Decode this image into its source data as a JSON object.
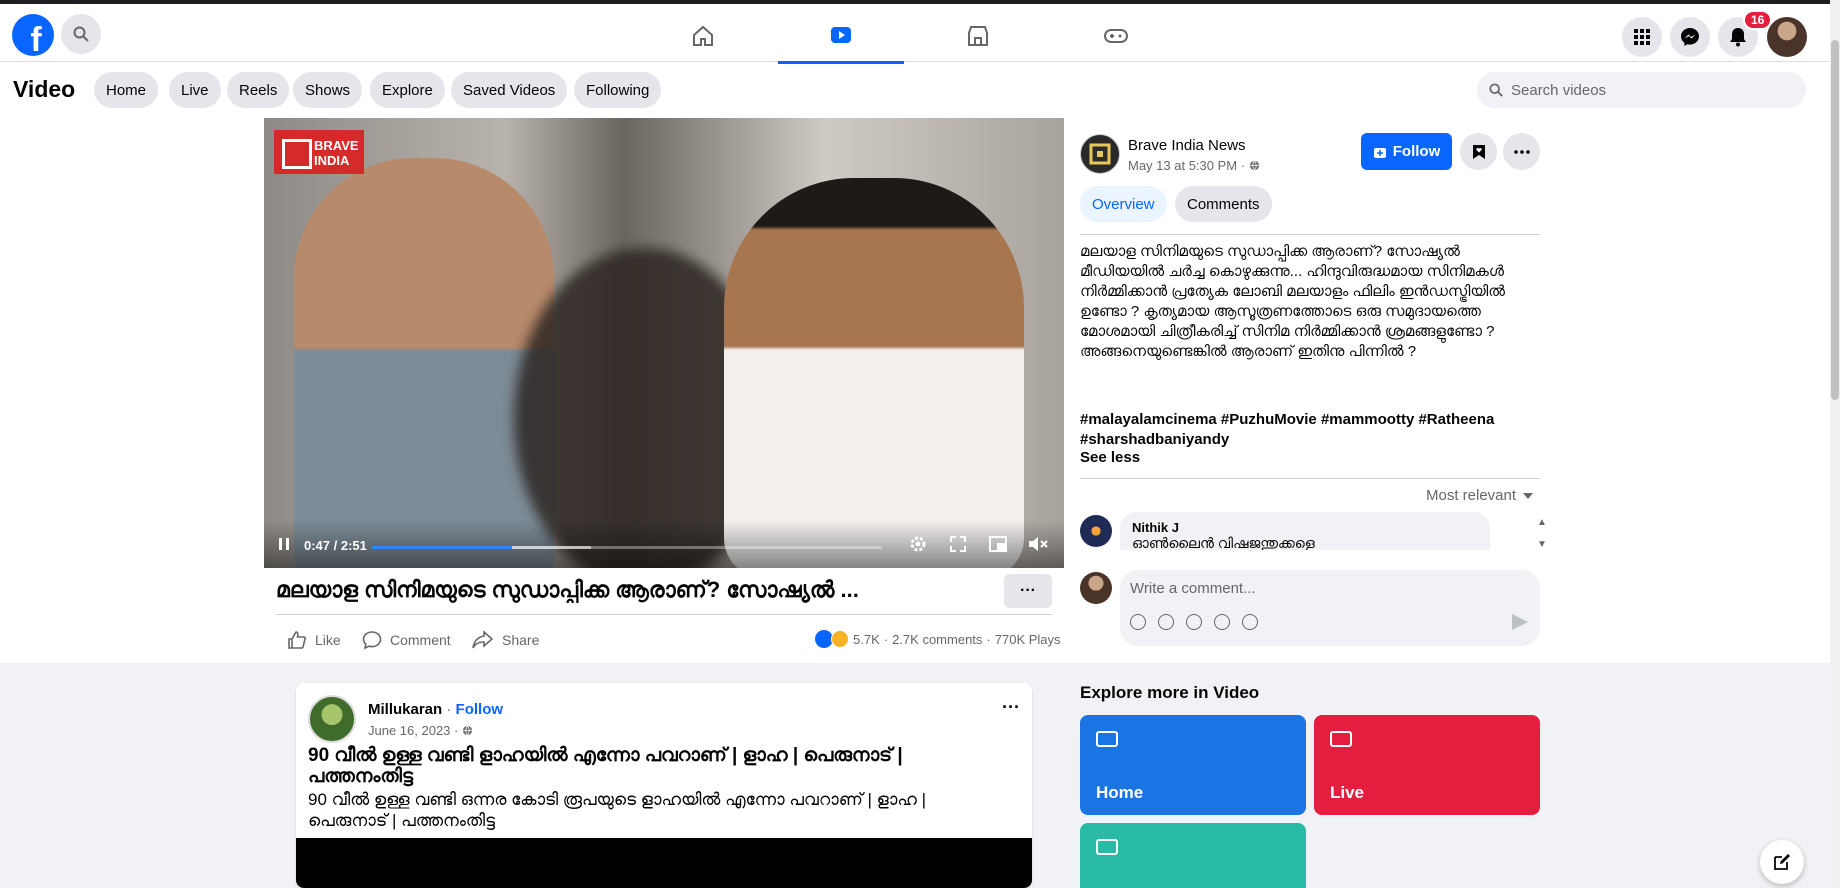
{
  "nav": {
    "notification_count": "16"
  },
  "video_header": {
    "title": "Video",
    "pills": [
      "Home",
      "Live",
      "Reels",
      "Shows",
      "Explore",
      "Saved Videos",
      "Following"
    ],
    "search_placeholder": "Search videos"
  },
  "player": {
    "logo_text": "BRAVE INDIA",
    "time": "0:47 / 2:51",
    "progress_fraction": 0.275,
    "buffer_fraction": 0.43
  },
  "video": {
    "title": "മലയാള സിനിമയുടെ സുഡാപ്പിക്ക ആരാണ്? സോഷ്യൽ ...",
    "more": "···",
    "actions": {
      "like": "Like",
      "comment": "Comment",
      "share": "Share"
    },
    "stats": {
      "reactions": "5.7K",
      "comments": "2.7K comments",
      "plays": "770K Plays"
    }
  },
  "channel": {
    "name": "Brave India News",
    "date": "May 13 at 5:30 PM ·",
    "follow_label": "Follow",
    "tabs": [
      "Overview",
      "Comments"
    ],
    "description": "മലയാള സിനിമയുടെ സുഡാപ്പിക്ക ആരാണ്? സോഷ്യൽ മീഡിയയിൽ ചർച്ച കൊഴുക്കുന്നു... ഹിന്ദുവിരുദ്ധമായ സിനിമകൾ നിർമ്മിക്കാൻ പ്രത്യേക ലോബി മലയാളം ഫിലിം ഇൻഡസ്ട്രിയിൽ ഉണ്ടോ ? കൃത്യമായ ആസൂത്രണത്തോടെ ഒരു സമുദായത്തെ മോശമായി ചിത്രീകരിച്ച് സിനിമ നിർമ്മിക്കാൻ ശ്രമങ്ങളുണ്ടോ ? അങ്ങനെയുണ്ടെങ്കിൽ ആരാണ് ഇതിനു പിന്നിൽ ?",
    "hashtags": "#malayalamcinema #PuzhuMovie #mammootty #Ratheena #sharshadbaniyandy",
    "see_less": "See less",
    "sort_label": "Most relevant"
  },
  "comments": {
    "first": {
      "name": "Nithik J",
      "text": "ഓൺലൈൻ വിഷജന്തുക്കളെ"
    },
    "input_placeholder": "Write a comment..."
  },
  "feed_post": {
    "author": "Millukaran",
    "follow": "Follow",
    "date": "June 16, 2023 ·",
    "more": "···",
    "title": "90 വീൽ ഉള്ള വണ്ടി ളാഹയിൽ എന്നോ പവറാണ് | ളാഹ | പെരുനാട് | പത്തനംതിട്ട",
    "text": "90 വീൽ ഉള്ള വണ്ടി ഒന്നര കോടി രൂപയുടെ ളാഹയിൽ എന്നോ പവറാണ് | ളാഹ | പെരുനാട് | പത്തനംതിട്ട"
  },
  "explore": {
    "title": "Explore more in Video",
    "tiles": [
      {
        "label": "Home",
        "color": "#1b74e4"
      },
      {
        "label": "Live",
        "color": "#e41e3f"
      },
      {
        "label": "",
        "color": "#2abba7"
      }
    ]
  },
  "colors": {
    "brand": "#0866ff",
    "badge": "#e41e3f"
  }
}
